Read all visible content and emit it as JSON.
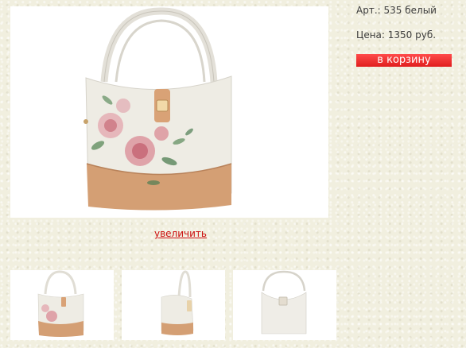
{
  "product": {
    "article_label": "Арт.:",
    "article_value": "535 белый",
    "price_label": "Цена:",
    "price_value": "1350 руб.",
    "cart_button": "в корзину",
    "zoom_link": "увеличить"
  },
  "gallery": {
    "thumbnails": [
      {
        "view": "front"
      },
      {
        "view": "side"
      },
      {
        "view": "back"
      }
    ]
  },
  "colors": {
    "background": "#f1efdf",
    "cart_button": "#e8262a",
    "link": "#cc1111",
    "bag_body": "#eeece4",
    "bag_bottom": "#d49f74"
  }
}
